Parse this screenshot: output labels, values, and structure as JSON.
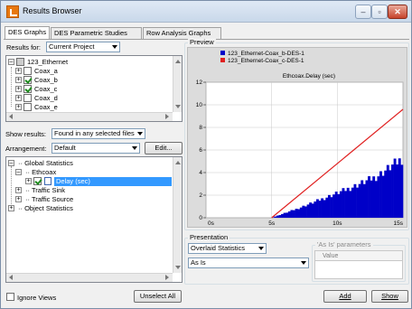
{
  "window": {
    "title": "Results Browser",
    "controls": {
      "minimize": "–",
      "maximize": "▫",
      "close": "✕"
    }
  },
  "tabs": [
    "DES Graphs",
    "DES Parametric Studies",
    "Row Analysis Graphs"
  ],
  "results_for": {
    "label": "Results for:",
    "value": "Current Project"
  },
  "project_tree": {
    "root": "123_Ethernet",
    "items": [
      {
        "label": "Coax_a",
        "checked": false
      },
      {
        "label": "Coax_b",
        "checked": true
      },
      {
        "label": "Coax_c",
        "checked": true
      },
      {
        "label": "Coax_d",
        "checked": false
      },
      {
        "label": "Coax_e",
        "checked": false
      }
    ]
  },
  "show_results": {
    "label": "Show results:",
    "value": "Found in any selected files"
  },
  "arrangement": {
    "label": "Arrangement:",
    "value": "Default",
    "edit_button": "Edit..."
  },
  "stats_tree": {
    "global": "Global Statistics",
    "ethcoax": "Ethcoax",
    "delay": "Delay (sec)",
    "traffic_sink": "Traffic Sink",
    "traffic_source": "Traffic Source",
    "object": "Object Statistics"
  },
  "ignore_views": "Ignore Views",
  "unselect_all": "Unselect All",
  "preview": {
    "label": "Preview"
  },
  "chart_data": {
    "type": "line",
    "title": "Ethcoax.Delay (sec)",
    "xlabel": "",
    "ylabel": "",
    "x_ticks": [
      "0s",
      "5s",
      "10s",
      "15s"
    ],
    "y_ticks": [
      "0",
      "2",
      "4",
      "6",
      "8",
      "10",
      "12"
    ],
    "xlim": [
      0,
      15
    ],
    "ylim": [
      0,
      12
    ],
    "grid": true,
    "legend_position": "top",
    "series": [
      {
        "name": "123_Ethernet-Coax_b-DES-1",
        "color": "#0000c8",
        "style": "filled-bars",
        "x": [
          5,
          7,
          9,
          11,
          13,
          15
        ],
        "y": [
          0,
          0.9,
          1.9,
          2.9,
          4.0,
          5.8
        ]
      },
      {
        "name": "123_Ethernet-Coax_c-DES-1",
        "color": "#e02020",
        "style": "line",
        "x": [
          5,
          15
        ],
        "y": [
          0,
          9.6
        ]
      }
    ]
  },
  "presentation": {
    "label": "Presentation",
    "statistic_mode": "Overlaid Statistics",
    "filter": "As Is",
    "params_label": "'As Is' parameters",
    "params_column": "Value"
  },
  "buttons": {
    "add": "Add",
    "show": "Show"
  }
}
